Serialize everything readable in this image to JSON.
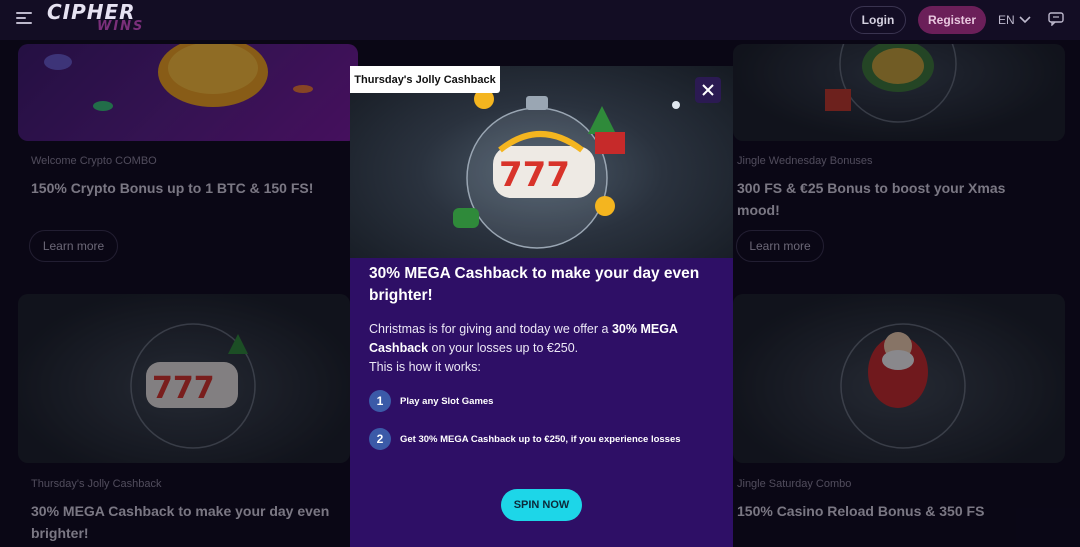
{
  "header": {
    "logo_top": "CIPHER",
    "logo_bottom": "WINS",
    "login_label": "Login",
    "register_label": "Register",
    "language": "EN"
  },
  "cards": [
    {
      "label": "Welcome Crypto COMBO",
      "title": "150% Crypto Bonus up to 1 BTC & 150 FS!",
      "button": "Learn more"
    },
    {
      "label": "Jingle Wednesday Bonuses",
      "title": "300 FS & €25 Bonus to boost your Xmas mood!",
      "button": "Learn more"
    },
    {
      "label": "Thursday's Jolly Cashback",
      "title": "30% MEGA Cashback to make your day even brighter!"
    },
    {
      "label": "Jingle Saturday Combo",
      "title": "150% Casino Reload Bonus & 350 FS"
    }
  ],
  "modal": {
    "tag": "Thursday's Jolly Cashback",
    "title": "30% MEGA Cashback to make your day even brighter!",
    "desc_part1": "Christmas is for giving and today we offer a ",
    "desc_bold": "30% MEGA Cashback",
    "desc_part2": " on your losses up to €250.",
    "how": "This is how it works:",
    "steps": [
      {
        "num": "1",
        "text": "Play any Slot Games"
      },
      {
        "num": "2",
        "text": "Get 30% MEGA Cashback up to €250, if you experience losses"
      }
    ],
    "cta": "SPIN NOW"
  },
  "colors": {
    "background": "#0e0a1c",
    "modal_bg": "#2e0f66",
    "cta": "#1dd6e8",
    "register": "#6b1f59",
    "step_badge": "#3b5aa8"
  }
}
